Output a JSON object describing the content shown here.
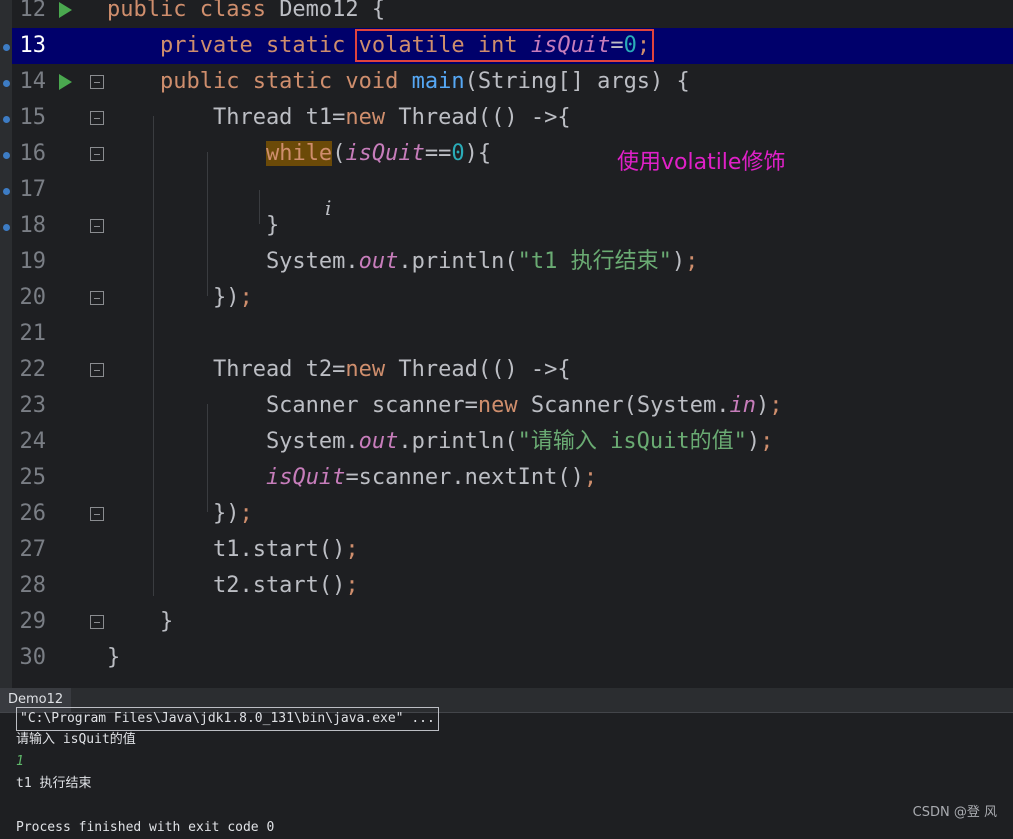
{
  "editor": {
    "lines": [
      {
        "num": "12",
        "tokens": [
          {
            "t": "public class ",
            "c": "kw"
          },
          {
            "t": "Demo12 {",
            "c": ""
          }
        ]
      },
      {
        "num": "13",
        "tokens": [
          {
            "t": "    private static ",
            "c": "kw"
          },
          {
            "t": "volatile int ",
            "c": "kw"
          },
          {
            "t": "isQuit",
            "c": "sf"
          },
          {
            "t": "=",
            "c": ""
          },
          {
            "t": "0",
            "c": "num"
          },
          {
            "t": ";",
            "c": "kw"
          }
        ]
      },
      {
        "num": "14",
        "tokens": [
          {
            "t": "    public static void ",
            "c": "kw"
          },
          {
            "t": "main",
            "c": "fn"
          },
          {
            "t": "(String[] args) {",
            "c": ""
          }
        ]
      },
      {
        "num": "15",
        "tokens": [
          {
            "t": "        Thread t1=",
            "c": ""
          },
          {
            "t": "new ",
            "c": "kw"
          },
          {
            "t": "Thread(() ->{",
            "c": ""
          }
        ]
      },
      {
        "num": "16",
        "tokens": [
          {
            "t": "            ",
            "c": ""
          },
          {
            "t": "while",
            "c": "kw hl"
          },
          {
            "t": "(",
            "c": ""
          },
          {
            "t": "isQuit",
            "c": "sf"
          },
          {
            "t": "==",
            "c": ""
          },
          {
            "t": "0",
            "c": "num"
          },
          {
            "t": "){",
            "c": ""
          }
        ]
      },
      {
        "num": "17",
        "tokens": []
      },
      {
        "num": "18",
        "tokens": [
          {
            "t": "            }",
            "c": ""
          }
        ]
      },
      {
        "num": "19",
        "tokens": [
          {
            "t": "            System.",
            "c": ""
          },
          {
            "t": "out",
            "c": "sf"
          },
          {
            "t": ".println(",
            "c": ""
          },
          {
            "t": "\"t1 执行结束\"",
            "c": "str"
          },
          {
            "t": ")",
            "c": ""
          },
          {
            "t": ";",
            "c": "kw"
          }
        ]
      },
      {
        "num": "20",
        "tokens": [
          {
            "t": "        })",
            "c": ""
          },
          {
            "t": ";",
            "c": "kw"
          }
        ]
      },
      {
        "num": "21",
        "tokens": []
      },
      {
        "num": "22",
        "tokens": [
          {
            "t": "        Thread t2=",
            "c": ""
          },
          {
            "t": "new ",
            "c": "kw"
          },
          {
            "t": "Thread(() ->{",
            "c": ""
          }
        ]
      },
      {
        "num": "23",
        "tokens": [
          {
            "t": "            Scanner scanner=",
            "c": ""
          },
          {
            "t": "new ",
            "c": "kw"
          },
          {
            "t": "Scanner(System.",
            "c": ""
          },
          {
            "t": "in",
            "c": "sf"
          },
          {
            "t": ")",
            "c": ""
          },
          {
            "t": ";",
            "c": "kw"
          }
        ]
      },
      {
        "num": "24",
        "tokens": [
          {
            "t": "            System.",
            "c": ""
          },
          {
            "t": "out",
            "c": "sf"
          },
          {
            "t": ".println(",
            "c": ""
          },
          {
            "t": "\"请输入 isQuit的值\"",
            "c": "str"
          },
          {
            "t": ")",
            "c": ""
          },
          {
            "t": ";",
            "c": "kw"
          }
        ]
      },
      {
        "num": "25",
        "tokens": [
          {
            "t": "            ",
            "c": ""
          },
          {
            "t": "isQuit",
            "c": "sf"
          },
          {
            "t": "=scanner.nextInt()",
            "c": ""
          },
          {
            "t": ";",
            "c": "kw"
          }
        ]
      },
      {
        "num": "26",
        "tokens": [
          {
            "t": "        })",
            "c": ""
          },
          {
            "t": ";",
            "c": "kw"
          }
        ]
      },
      {
        "num": "27",
        "tokens": [
          {
            "t": "        t1.start()",
            "c": ""
          },
          {
            "t": ";",
            "c": "kw"
          }
        ]
      },
      {
        "num": "28",
        "tokens": [
          {
            "t": "        t2.start()",
            "c": ""
          },
          {
            "t": ";",
            "c": "kw"
          }
        ]
      },
      {
        "num": "29",
        "tokens": [
          {
            "t": "    }",
            "c": ""
          }
        ]
      },
      {
        "num": "30",
        "tokens": [
          {
            "t": "}",
            "c": ""
          }
        ]
      }
    ],
    "annotation": "使用volatile修饰"
  },
  "console": {
    "tab_label": "Demo12",
    "command": "\"C:\\Program Files\\Java\\jdk1.8.0_131\\bin\\java.exe\" ...",
    "output": [
      "请输入 isQuit的值",
      "1",
      "t1 执行结束",
      "",
      "Process finished with exit code 0"
    ]
  },
  "watermark": "CSDN @登 风"
}
